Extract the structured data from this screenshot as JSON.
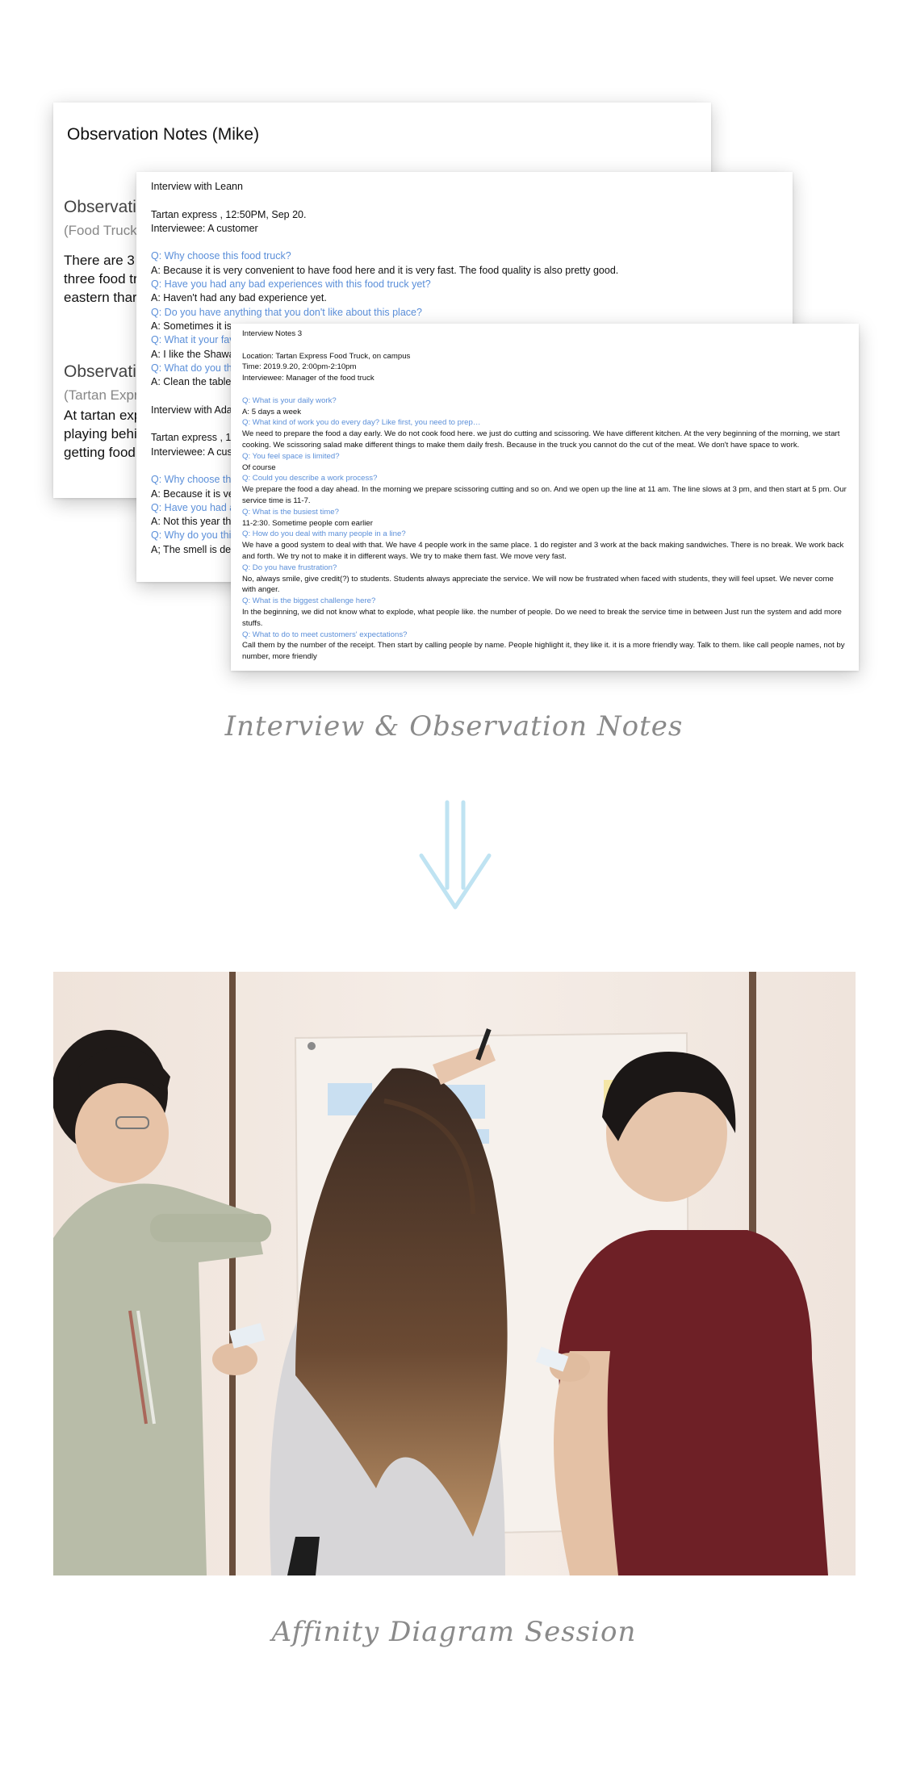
{
  "card1": {
    "title": "Observation Notes (Mike)",
    "section1": {
      "heading": "Observati",
      "sub": "(Food Truck",
      "lines": [
        "There are 3",
        "three food tr",
        "eastern thar"
      ]
    },
    "section2": {
      "heading": "Observati",
      "sub": "(Tartan Expr",
      "lines": [
        "At tartan exp",
        "playing behi",
        "getting food."
      ]
    }
  },
  "card2": {
    "lines": [
      {
        "t": "Interview with Leann",
        "q": false
      },
      {
        "t": "",
        "q": false
      },
      {
        "t": "Tartan express , 12:50PM, Sep 20.",
        "q": false
      },
      {
        "t": "Interviewee: A customer",
        "q": false
      },
      {
        "t": "",
        "q": false
      },
      {
        "t": "Q: Why choose this food truck?",
        "q": true
      },
      {
        "t": "A: Because it is very convenient to have food here and it is very fast. The food quality is also pretty good.",
        "q": false
      },
      {
        "t": "Q: Have you had any bad experiences with this food truck yet?",
        "q": true
      },
      {
        "t": "A: Haven't had any bad experience yet.",
        "q": false
      },
      {
        "t": "Q: Do you have anything that you don't like about this place?",
        "q": true
      },
      {
        "t": "A: Sometimes it is",
        "q": false
      },
      {
        "t": "Q: What it your fav",
        "q": true
      },
      {
        "t": "A: I like the Shawa",
        "q": false
      },
      {
        "t": "Q: What do you th",
        "q": true
      },
      {
        "t": "A: Clean the table",
        "q": false
      },
      {
        "t": "",
        "q": false
      },
      {
        "t": "Interview with Ada",
        "q": false
      },
      {
        "t": "",
        "q": false
      },
      {
        "t": "Tartan express , 1",
        "q": false
      },
      {
        "t": "Interviewee: A cus",
        "q": false
      },
      {
        "t": "",
        "q": false
      },
      {
        "t": "Q: Why choose th",
        "q": true
      },
      {
        "t": "A: Because it is ve",
        "q": false
      },
      {
        "t": "Q: Have you had a",
        "q": true
      },
      {
        "t": "A: Not this year th",
        "q": false
      },
      {
        "t": "Q: Why do you thi",
        "q": true
      },
      {
        "t": "A; The smell is det",
        "q": false
      }
    ]
  },
  "card3": {
    "lines": [
      {
        "t": "Interview Notes 3",
        "q": false
      },
      {
        "t": "",
        "q": false
      },
      {
        "t": "Location: Tartan Express Food Truck, on campus",
        "q": false
      },
      {
        "t": "Time: 2019.9.20, 2:00pm-2:10pm",
        "q": false
      },
      {
        "t": "Interviewee: Manager of the food truck",
        "q": false
      },
      {
        "t": "",
        "q": false
      },
      {
        "t": "Q: What is your daily work?",
        "q": true
      },
      {
        "t": "A: 5 days a week",
        "q": false
      },
      {
        "t": "Q: What kind of work you do every day? Like first, you need to prep…",
        "q": true
      },
      {
        "t": "We need to prepare the food a day early. We do not cook food here. we just do cutting and scissoring. We have different kitchen. At the very beginning of the morning, we start cooking. We scissoring salad make different things to make them daily fresh. Because in the truck you cannot do the cut of the meat. We don't have space to work.",
        "q": false
      },
      {
        "t": "Q: You feel space is limited?",
        "q": true
      },
      {
        "t": "Of course",
        "q": false
      },
      {
        "t": "Q: Could you describe a work process?",
        "q": true
      },
      {
        "t": "We prepare the food a day ahead. In the morning we prepare scissoring cutting and so on. And we open up the line at 11 am. The line slows at 3 pm, and then start at 5 pm. Our service time is 11-7.",
        "q": false
      },
      {
        "t": "Q: What is the busiest time?",
        "q": true
      },
      {
        "t": "11-2:30. Sometime people com earlier",
        "q": false
      },
      {
        "t": "Q: How do you deal with many people in a line?",
        "q": true
      },
      {
        "t": "We have a good system to deal with that. We have 4 people work in the same place. 1 do register and 3 work at the back making sandwiches. There is no break. We work back and forth. We try not to make it in different ways. We try to make them fast. We move very fast.",
        "q": false
      },
      {
        "t": "Q: Do you have frustration?",
        "q": true
      },
      {
        "t": "No, always smile, give credit(?) to students. Students always appreciate the service. We will now be frustrated when faced with students, they will feel upset. We never come with anger.",
        "q": false
      },
      {
        "t": "Q: What is the biggest challenge here?",
        "q": true
      },
      {
        "t": "In the beginning, we did not know what to explode, what people like. the number of people. Do we need to break the service time in between Just run the system and add more stuffs.",
        "q": false
      },
      {
        "t": "Q: What to do to meet customers' expectations?",
        "q": true
      },
      {
        "t": "Call them by the number of the receipt. Then start by calling people by name. People highlight it, they like it. it is a more friendly way. Talk to them.  like call people names, not by number, more friendly",
        "q": false
      }
    ]
  },
  "captions": {
    "notes": "Interview & Observation Notes",
    "session": "Affinity Diagram Session"
  },
  "colors": {
    "question": "#5b8fd9",
    "arrow": "#bfe3f2",
    "caption": "#8a8a8a"
  },
  "icons": {
    "arrow": "double-down-arrow-icon"
  }
}
